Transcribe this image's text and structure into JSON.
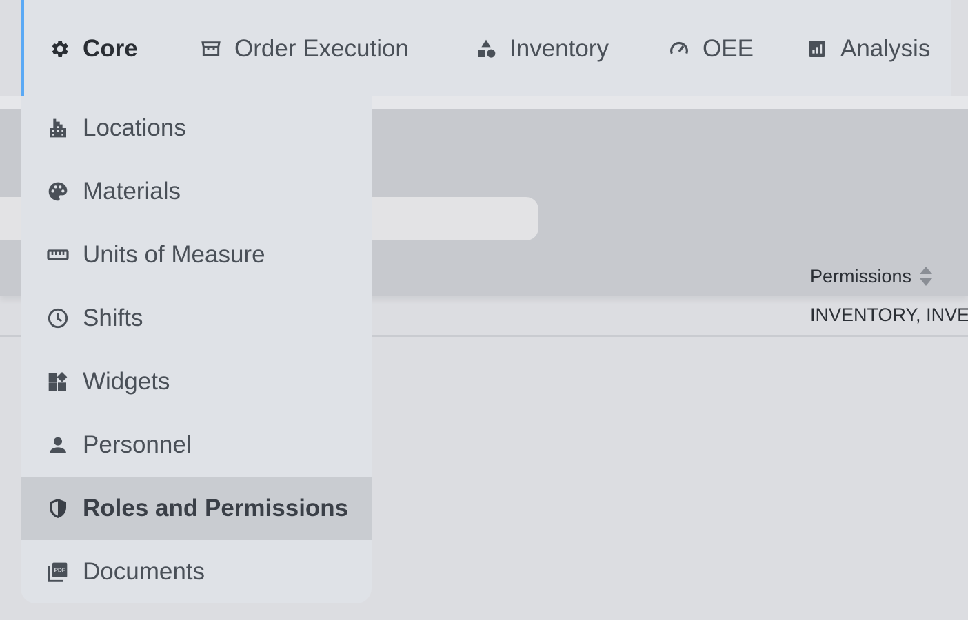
{
  "topnav": {
    "items": [
      {
        "label": "Core",
        "icon": "gear-icon",
        "active": true
      },
      {
        "label": "Order Execution",
        "icon": "storefront-icon",
        "active": false
      },
      {
        "label": "Inventory",
        "icon": "shapes-icon",
        "active": false
      },
      {
        "label": "OEE",
        "icon": "speedometer-icon",
        "active": false
      },
      {
        "label": "Analysis",
        "icon": "bar-chart-icon",
        "active": false
      }
    ],
    "accent_color": "#5aa9f5"
  },
  "dropdown": {
    "items": [
      {
        "label": "Locations",
        "icon": "buildings-icon"
      },
      {
        "label": "Materials",
        "icon": "palette-icon"
      },
      {
        "label": "Units of Measure",
        "icon": "ruler-icon"
      },
      {
        "label": "Shifts",
        "icon": "clock-icon"
      },
      {
        "label": "Widgets",
        "icon": "widgets-icon"
      },
      {
        "label": "Personnel",
        "icon": "person-icon"
      },
      {
        "label": "Roles and Permissions",
        "icon": "shield-icon",
        "selected": true
      },
      {
        "label": "Documents",
        "icon": "pdf-icon"
      }
    ]
  },
  "table": {
    "column_header": "Permissions",
    "rows": [
      {
        "permissions": "INVENTORY, INVENTORY"
      }
    ]
  }
}
